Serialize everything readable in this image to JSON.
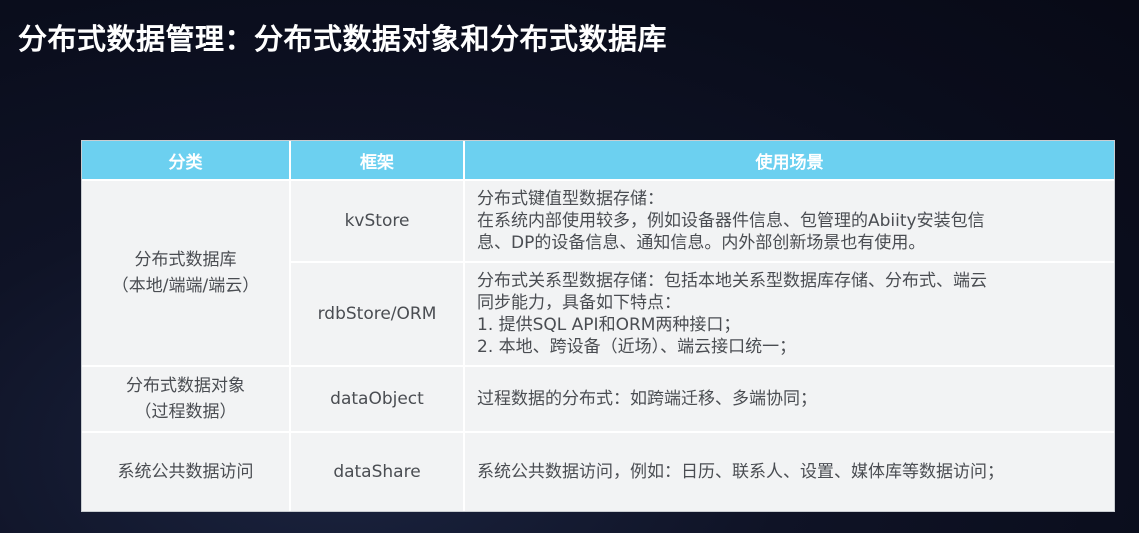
{
  "title": "分布式数据管理：分布式数据对象和分布式数据库",
  "table": {
    "headers": [
      "分类",
      "框架",
      "使用场景"
    ],
    "rows": [
      {
        "category": [
          "分布式数据库",
          "（本地/端端/端云）"
        ],
        "framework": "kvStore",
        "usage": [
          "分布式键值型数据存储：",
          "在系统内部使用较多，例如设备器件信息、包管理的Abiity安装包信",
          "息、DP的设备信息、通知信息。内外部创新场景也有使用。"
        ]
      },
      {
        "framework": "rdbStore/ORM",
        "usage": [
          "分布式关系型数据存储：包括本地关系型数据库存储、分布式、端云",
          "同步能力，具备如下特点：",
          "1. 提供SQL API和ORM两种接口；",
          "2. 本地、跨设备（近场）、端云接口统一；"
        ]
      },
      {
        "category": [
          "分布式数据对象",
          "（过程数据）"
        ],
        "framework": "dataObject",
        "usage": [
          "过程数据的分布式：如跨端迁移、多端协同；"
        ]
      },
      {
        "category": [
          "系统公共数据访问"
        ],
        "framework": "dataShare",
        "usage": [
          "系统公共数据访问，例如：日历、联系人、设置、媒体库等数据访问；"
        ]
      }
    ]
  },
  "colors": {
    "header_bg": "#6cd0f0",
    "table_bg": "#f2f3f4",
    "page_bg": "#0f1326"
  }
}
